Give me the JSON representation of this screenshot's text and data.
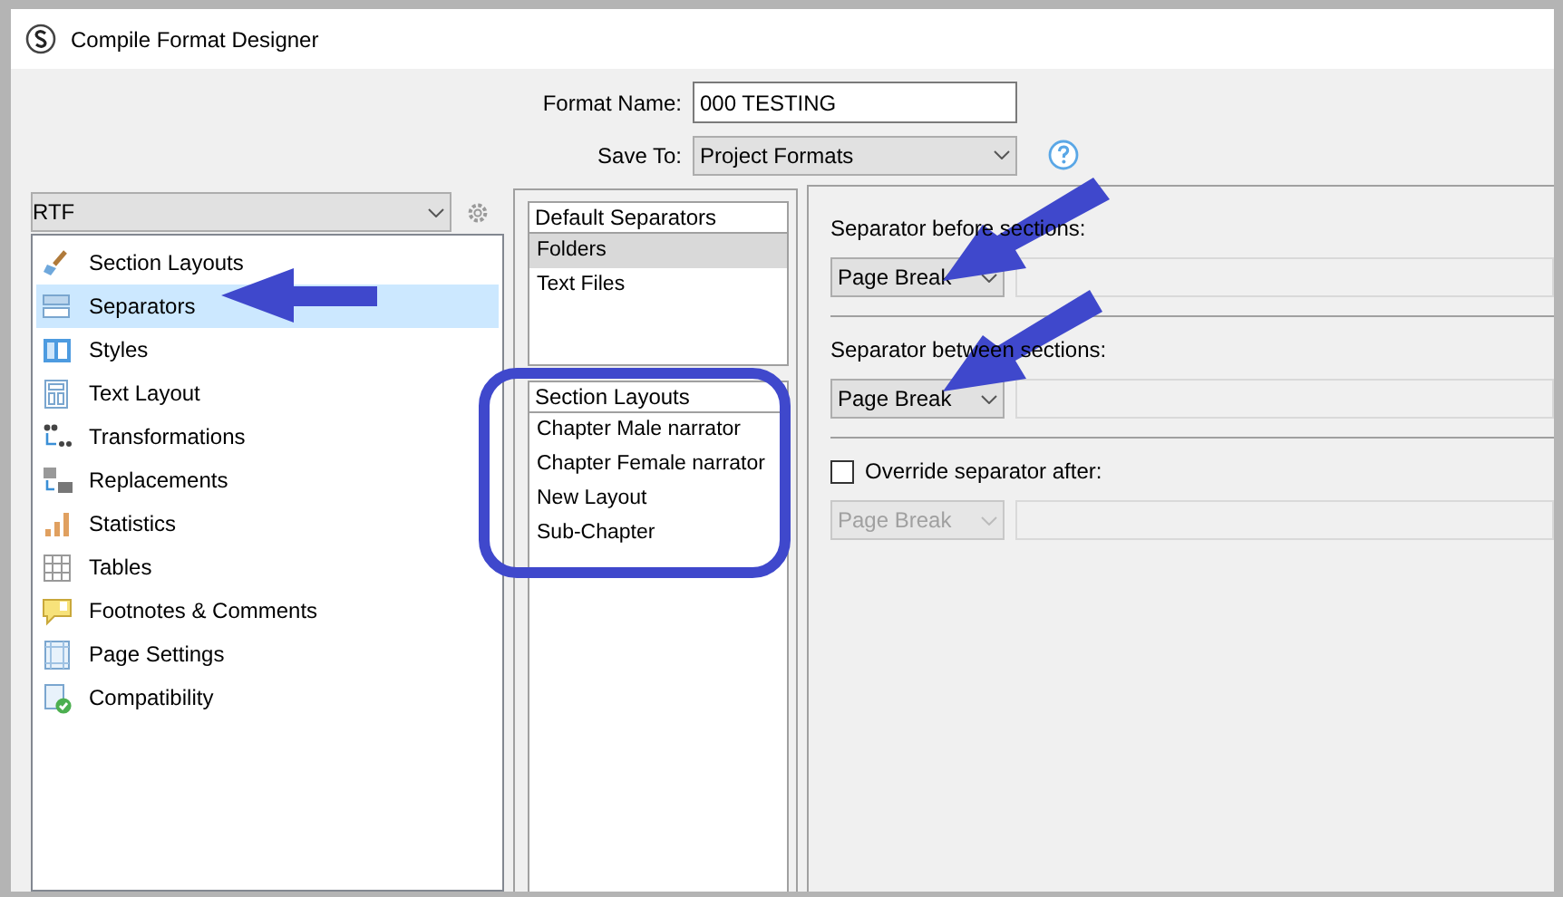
{
  "window": {
    "title": "Compile Format Designer"
  },
  "format_name": {
    "label": "Format Name:",
    "value": "000 TESTING"
  },
  "save_to": {
    "label": "Save To:",
    "value": "Project Formats"
  },
  "output_format": {
    "value": "RTF"
  },
  "sidebar": {
    "items": [
      {
        "label": "Section Layouts",
        "selected": false
      },
      {
        "label": "Separators",
        "selected": true
      },
      {
        "label": "Styles",
        "selected": false
      },
      {
        "label": "Text Layout",
        "selected": false
      },
      {
        "label": "Transformations",
        "selected": false
      },
      {
        "label": "Replacements",
        "selected": false
      },
      {
        "label": "Statistics",
        "selected": false
      },
      {
        "label": "Tables",
        "selected": false
      },
      {
        "label": "Footnotes & Comments",
        "selected": false
      },
      {
        "label": "Page Settings",
        "selected": false
      },
      {
        "label": "Compatibility",
        "selected": false
      }
    ]
  },
  "default_separators": {
    "header": "Default Separators",
    "items": [
      {
        "label": "Folders",
        "selected": true
      },
      {
        "label": "Text Files",
        "selected": false
      }
    ]
  },
  "section_layouts": {
    "header": "Section Layouts",
    "items": [
      {
        "label": "Chapter Male narrator",
        "selected": false
      },
      {
        "label": "Chapter Female narrator",
        "selected": false
      },
      {
        "label": "New Layout",
        "selected": false
      },
      {
        "label": "Sub-Chapter",
        "selected": false
      }
    ]
  },
  "separator_settings": [
    {
      "kind": "select",
      "label": "Separator before sections:",
      "value": "Page Break",
      "disabled": false
    },
    {
      "kind": "select",
      "label": "Separator between sections:",
      "value": "Page Break",
      "disabled": false
    },
    {
      "kind": "checkbox",
      "label": "Override separator after:",
      "checked": false,
      "value": "Page Break",
      "disabled": true
    }
  ]
}
